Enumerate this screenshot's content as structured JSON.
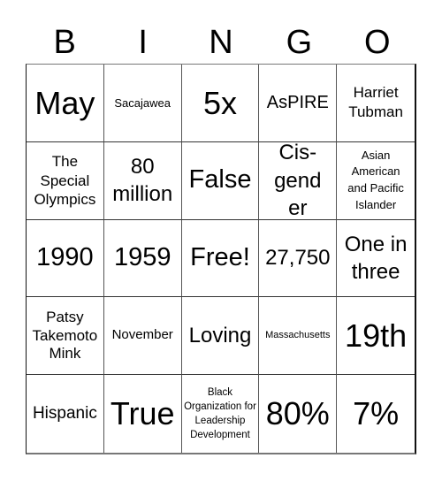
{
  "header": {
    "letters": [
      "B",
      "I",
      "N",
      "G",
      "O"
    ]
  },
  "board": {
    "rows": [
      [
        "May",
        "Sacajawea",
        "5x",
        "AsPIRE",
        "Harriet Tubman"
      ],
      [
        "The Special Olympics",
        "80 million",
        "False",
        "Cis-gender",
        "Asian American and Pacific Islander"
      ],
      [
        "1990",
        "1959",
        "Free!",
        "27,750",
        "One in three"
      ],
      [
        "Patsy Takemoto Mink",
        "November",
        "Loving",
        "Massachusetts",
        "19th"
      ],
      [
        "Hispanic",
        "True",
        "Black Organization for Leadership Development",
        "80%",
        "7%"
      ]
    ],
    "free_space": "Free!"
  }
}
